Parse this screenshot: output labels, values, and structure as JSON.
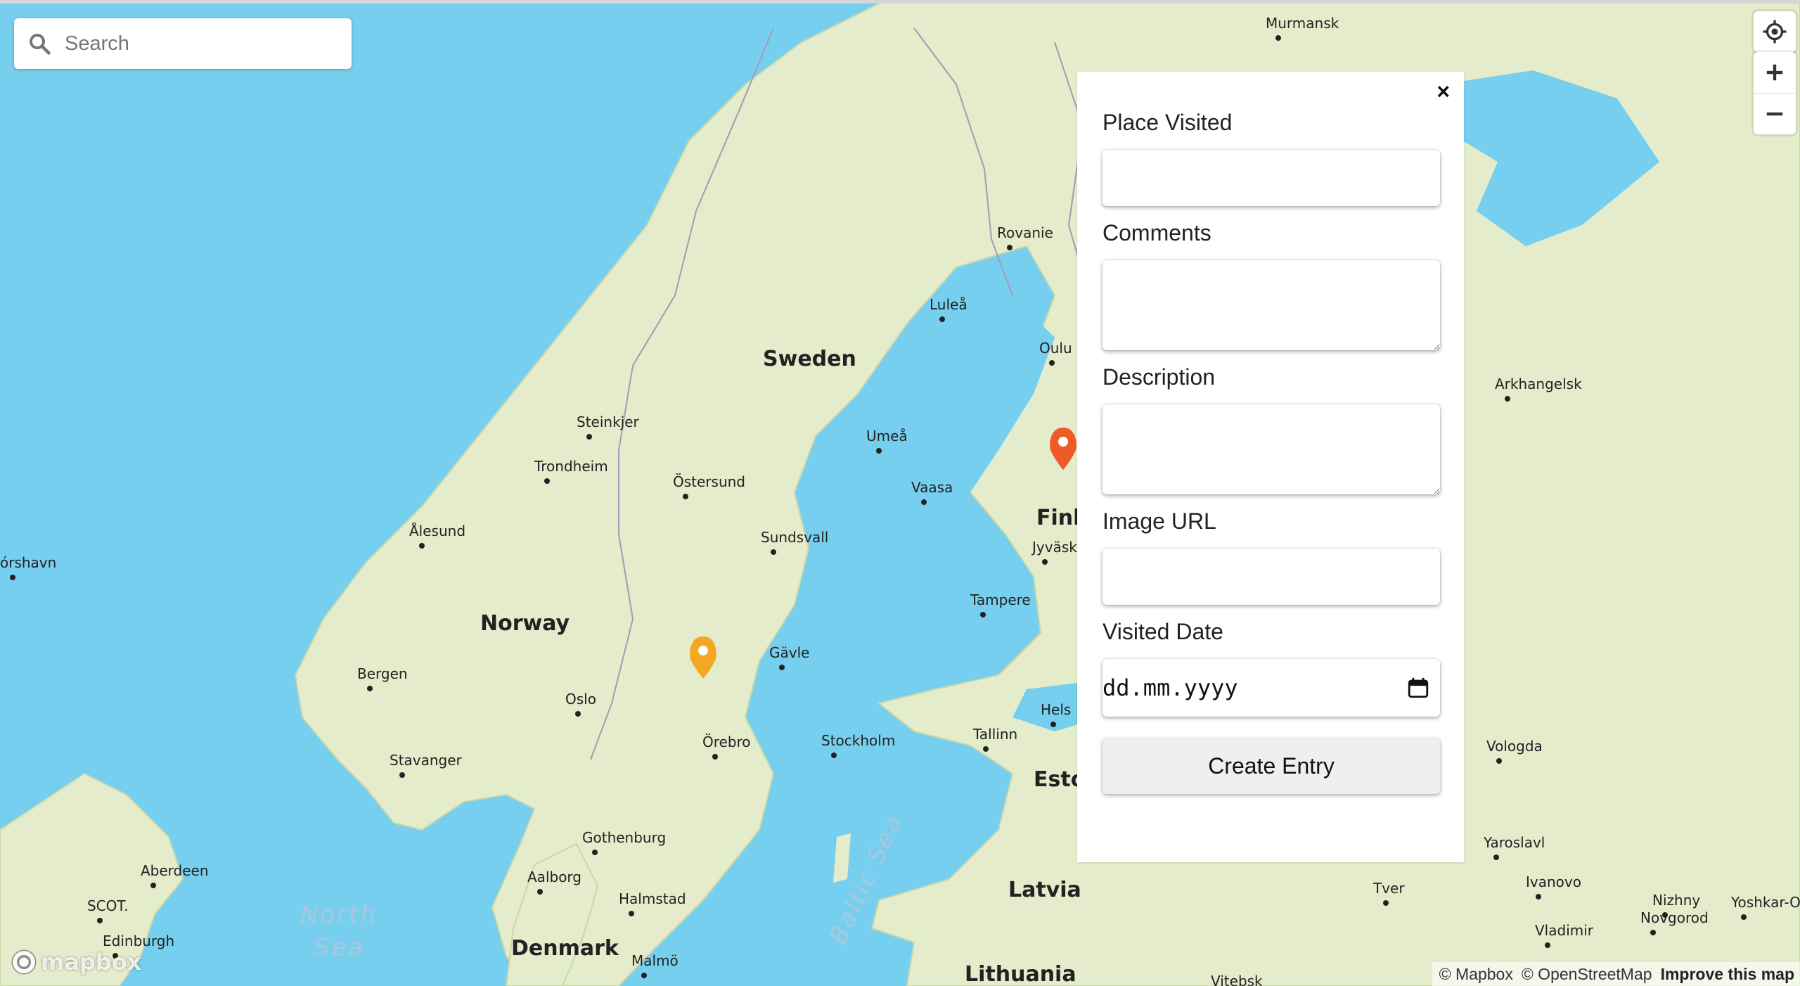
{
  "search": {
    "placeholder": "Search",
    "icon": "search-icon"
  },
  "controls": {
    "geolocate_icon": "geolocate-icon",
    "zoom_in_icon": "plus-icon",
    "zoom_out_icon": "minus-icon"
  },
  "map": {
    "countries": [
      "Sweden",
      "Norway",
      "Finl",
      "Denmark",
      "Latvia",
      "Lithuania",
      "Eston"
    ],
    "seas": [
      "North",
      "Sea",
      "Baltic Sea"
    ],
    "cities": [
      "Murmansk",
      "Rovanie",
      "Luleå",
      "Oulu",
      "Arkhangelsk",
      "Steinkjer",
      "Trondheim",
      "Östersund",
      "Umeå",
      "Vaasa",
      "Ålesund",
      "Sundsvall",
      "Jyväsky",
      "órshavn",
      "Tampere",
      "Bergen",
      "Gävle",
      "Oslo",
      "Hels",
      "Tallinn",
      "Örebro",
      "Stockholm",
      "Stavanger",
      "Vologda",
      "Gothenburg",
      "Yaroslavl",
      "Aberdeen",
      "Aalborg",
      "Ivanovo",
      "Tver",
      "Nizhny",
      "Novgorod",
      "Yoshkar-O",
      "SCOT.",
      "Halmstad",
      "Vladimir",
      "Edinburgh",
      "Malmö",
      "Vitebsk"
    ],
    "markers": [
      {
        "name": "marker-orange",
        "color": "#f5a623"
      },
      {
        "name": "marker-red",
        "color": "#f05a28"
      }
    ]
  },
  "form": {
    "close_label": "×",
    "place_label": "Place Visited",
    "place_value": "",
    "comments_label": "Comments",
    "comments_value": "",
    "description_label": "Description",
    "description_value": "",
    "image_label": "Image URL",
    "image_value": "",
    "date_label": "Visited Date",
    "date_placeholder": "dd.mm.yyyy",
    "date_icon": "calendar-icon",
    "submit_label": "Create Entry"
  },
  "attribution": {
    "mapbox": "© Mapbox",
    "osm": "© OpenStreetMap",
    "improve": "Improve this map"
  },
  "logo_text": "mapbox",
  "colors": {
    "water": "#76cfee",
    "land": "#e4eccb",
    "marker_orange": "#f5a623",
    "marker_red": "#f05a28"
  }
}
